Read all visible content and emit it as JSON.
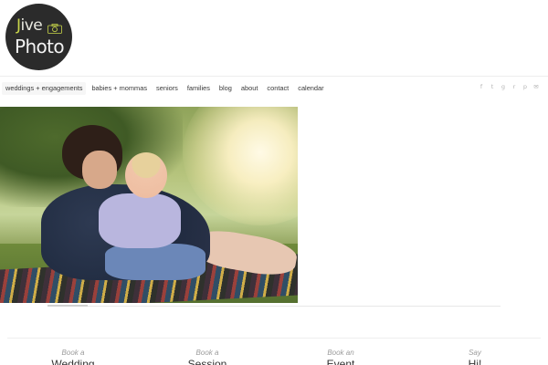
{
  "logo": {
    "line1_initial": "J",
    "line1_rest": "ive",
    "line2": "Photo"
  },
  "nav": {
    "items": [
      "weddings + engagements",
      "babies + mommas",
      "seniors",
      "families",
      "blog",
      "about",
      "contact",
      "calendar"
    ]
  },
  "social": {
    "icons": [
      "facebook-icon",
      "twitter-icon",
      "google-plus-icon",
      "rss-icon",
      "pinterest-icon",
      "email-icon"
    ],
    "glyphs": [
      "f",
      "t",
      "g",
      "r",
      "p",
      "✉"
    ]
  },
  "hero": {
    "alt_subject": "mother-and-son-photo"
  },
  "ctas": [
    {
      "small": "Book a",
      "big": "Wedding"
    },
    {
      "small": "Book a",
      "big": "Session"
    },
    {
      "small": "Book an",
      "big": "Event"
    },
    {
      "small": "Say",
      "big": "Hi!"
    }
  ],
  "colors": {
    "logo_bg": "#2b2b2b",
    "logo_accent": "#c9d64a",
    "nav_text": "#3a3a3a",
    "social_grey": "#b5b5b5"
  }
}
